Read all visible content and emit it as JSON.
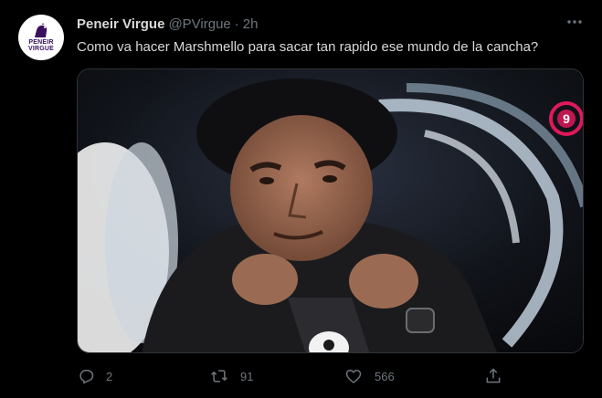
{
  "tweet": {
    "author_name": "Peneir Virgue",
    "handle": "@PVirgue",
    "separator": "·",
    "time": "2h",
    "text": "Como va hacer Marshmello para sacar tan rapido ese mundo de la cancha?",
    "avatar_text": [
      "PENEIR",
      "VIRGUE"
    ]
  },
  "media": {
    "description_icon": "video-still-image",
    "channel_logo_text": "9"
  },
  "actions": {
    "reply_count": "2",
    "retweet_count": "91",
    "like_count": "566"
  },
  "icons": {
    "more": "more-icon",
    "reply": "reply-icon",
    "retweet": "retweet-icon",
    "like": "like-icon",
    "share": "share-icon"
  },
  "colors": {
    "background": "#000000",
    "text": "#d9d9d9",
    "muted": "#6e767d",
    "channel_logo": "#e0195a"
  }
}
